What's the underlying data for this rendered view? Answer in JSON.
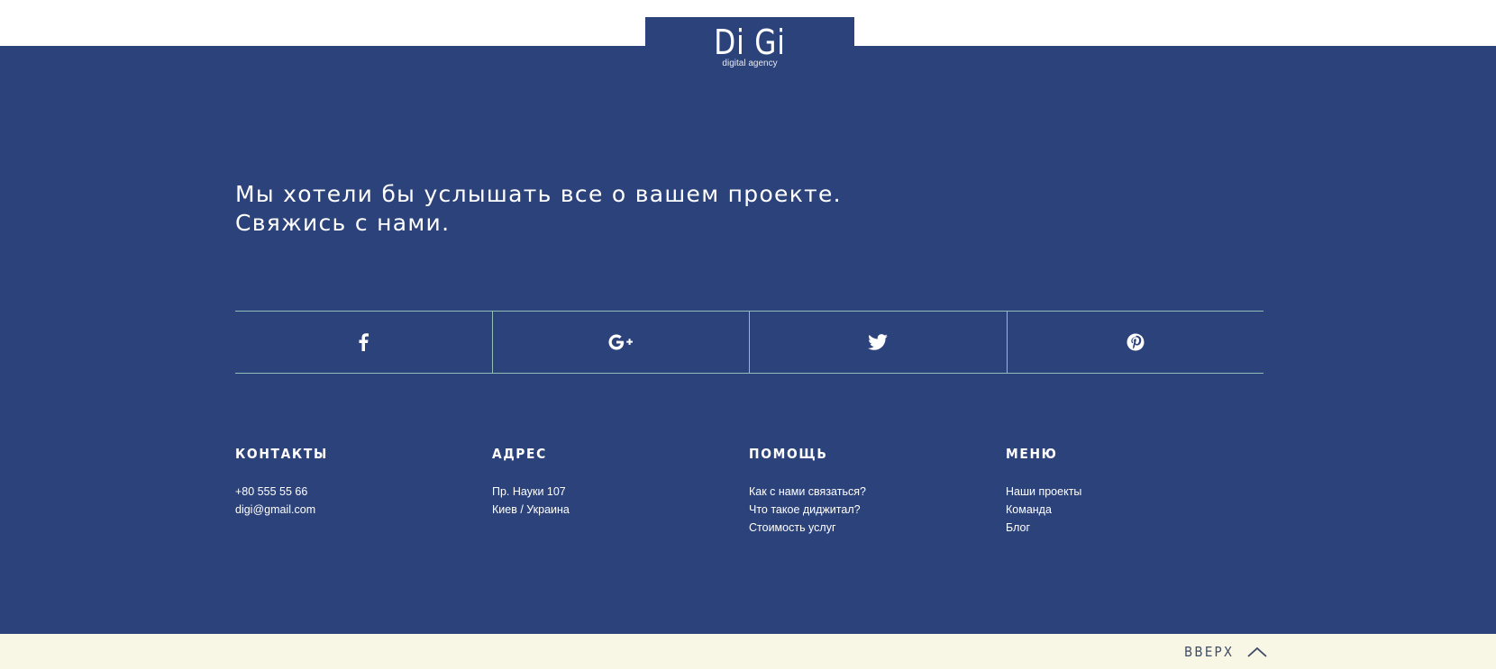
{
  "logo": {
    "title": "Di Gi",
    "subtitle": "digital agency"
  },
  "headline": {
    "line1": "Мы хотели бы услышать все о вашем проекте.",
    "line2": "Свяжись с нами."
  },
  "social": [
    {
      "icon": "facebook-icon"
    },
    {
      "icon": "google-plus-icon"
    },
    {
      "icon": "twitter-icon"
    },
    {
      "icon": "pinterest-icon"
    }
  ],
  "columns": {
    "contacts": {
      "title": "КОНТАКТЫ",
      "items": [
        "+80 555 55 66",
        "digi@gmail.com"
      ]
    },
    "address": {
      "title": "АДРЕС",
      "items": [
        "Пр. Науки 107",
        "Киев / Украина"
      ]
    },
    "help": {
      "title": "ПОМОЩЬ",
      "items": [
        "Как с нами связаться?",
        "Что такое диджитал?",
        "Стоимость услуг"
      ]
    },
    "menu": {
      "title": "МЕНЮ",
      "items": [
        "Наши проекты",
        "Команда",
        "Блог"
      ]
    }
  },
  "back_to_top": {
    "label": "ВВЕРХ",
    "icon": "chevron-up-icon"
  },
  "colors": {
    "footer_bg": "#2c427a",
    "divider": "#8fbfb7",
    "bottom_bar_bg": "#f8f6e4",
    "text": "#ffffff"
  }
}
